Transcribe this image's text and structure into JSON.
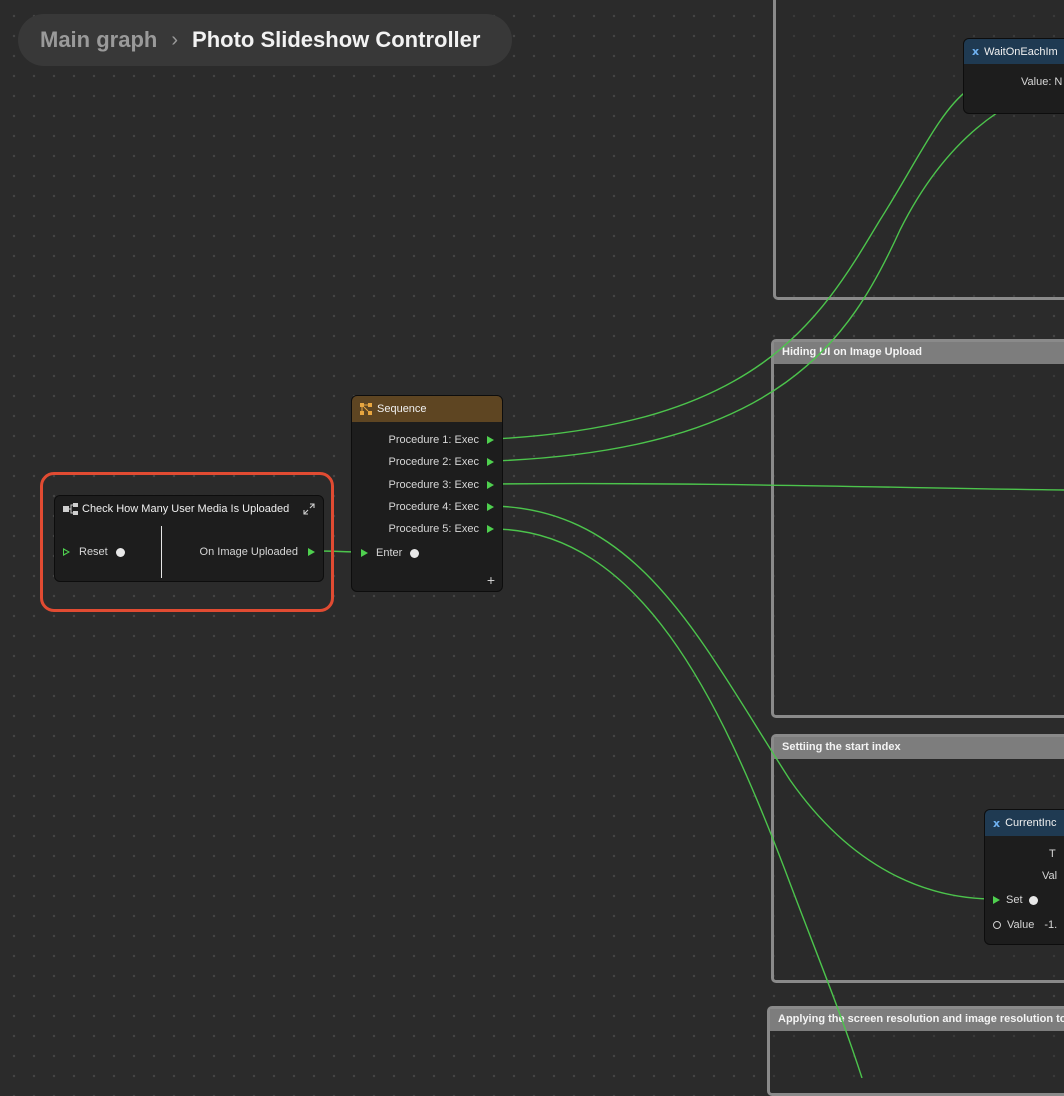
{
  "breadcrumb": {
    "root": "Main graph",
    "separator": "›",
    "current": "Photo Slideshow Controller"
  },
  "groups": {
    "hiding_ui": "Hiding UI on Image Upload",
    "start_index": "Settiing the start index",
    "resolution": "Applying the screen resolution and image resolution to the"
  },
  "check_node": {
    "title": "Check How Many User Media Is Uploaded",
    "reset_label": "Reset",
    "output_label": "On Image Uploaded",
    "icon": "event-node-icon",
    "expand_icon": "expand-icon"
  },
  "sequence_node": {
    "title": "Sequence",
    "icon": "sequence-icon",
    "header_color": "#5e4522",
    "outputs": [
      "Procedure 1: Exec",
      "Procedure 2: Exec",
      "Procedure 3: Exec",
      "Procedure 4: Exec",
      "Procedure 5: Exec"
    ],
    "enter_label": "Enter",
    "add_label": "+"
  },
  "wait_node": {
    "title": "WaitOnEachIm",
    "value_label": "Value: N"
  },
  "current_index_node": {
    "title": "CurrentInc",
    "row1": "T",
    "row2": "Val",
    "set_label": "Set",
    "value_label": "Value",
    "value": "-1."
  },
  "colors": {
    "wire": "#4cc44c",
    "highlight": "#e14b32",
    "variable_header": "#1f3a52"
  }
}
